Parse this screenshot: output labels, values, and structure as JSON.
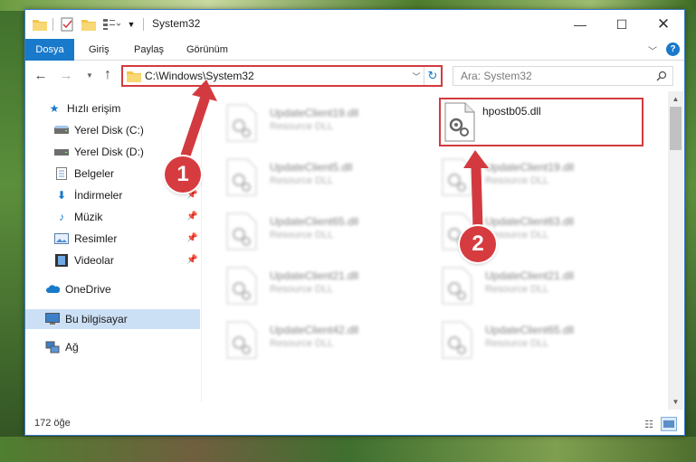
{
  "window": {
    "title": "System32",
    "controls": {
      "minimize": "—",
      "maximize": "☐",
      "close": "✕"
    }
  },
  "ribbon": {
    "tabs": [
      "Dosya",
      "Giriş",
      "Paylaş",
      "Görünüm"
    ],
    "help": "?"
  },
  "navigation": {
    "address": "C:\\Windows\\System32",
    "search_placeholder": "Ara: System32"
  },
  "sidebar": {
    "items": [
      {
        "label": "Hızlı erişim",
        "icon": "star-icon"
      },
      {
        "label": "Yerel Disk (C:)",
        "icon": "drive-icon"
      },
      {
        "label": "Yerel Disk (D:)",
        "icon": "drive-icon"
      },
      {
        "label": "Belgeler",
        "icon": "document-icon"
      },
      {
        "label": "İndirmeler",
        "icon": "download-icon"
      },
      {
        "label": "Müzik",
        "icon": "music-icon"
      },
      {
        "label": "Resimler",
        "icon": "picture-icon"
      },
      {
        "label": "Videolar",
        "icon": "video-icon"
      },
      {
        "label": "OneDrive",
        "icon": "cloud-icon"
      },
      {
        "label": "Bu bilgisayar",
        "icon": "computer-icon"
      },
      {
        "label": "Ağ",
        "icon": "network-icon"
      }
    ]
  },
  "files": {
    "highlighted": {
      "name": "hpostb05.dll"
    },
    "left_column": [
      {
        "name": "UpdateClient19.dll",
        "type": "Resource DLL"
      },
      {
        "name": "UpdateClient5.dll",
        "type": "Resource DLL"
      },
      {
        "name": "UpdateClient65.dll",
        "type": "Resource DLL"
      },
      {
        "name": "UpdateClient21.dll",
        "type": "Resource DLL"
      },
      {
        "name": "UpdateClient42.dll",
        "type": "Resource DLL"
      }
    ],
    "right_column": [
      {
        "name": "UpdateClient19.dll",
        "type": "Resource DLL"
      },
      {
        "name": "UpdateClient63.dll",
        "type": "Resource DLL"
      },
      {
        "name": "UpdateClient21.dll",
        "type": "Resource DLL"
      },
      {
        "name": "UpdateClient65.dll",
        "type": "Resource DLL"
      }
    ]
  },
  "status": {
    "item_count": "172 öğe"
  },
  "annotations": {
    "step1": "1",
    "step2": "2"
  },
  "colors": {
    "accent": "#1979ca",
    "annotation": "#d33a3f",
    "selected": "#cce0f5"
  }
}
